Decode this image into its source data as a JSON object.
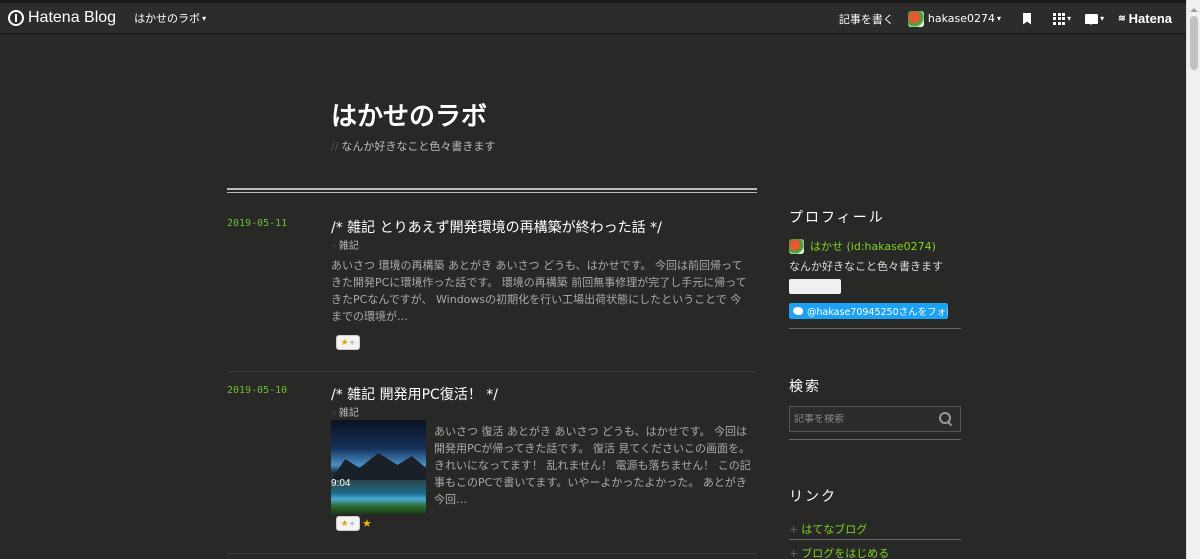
{
  "topbar": {
    "brand": "Hatena Blog",
    "blog_menu": "はかせのラボ",
    "write_label": "記事を書く",
    "username": "hakase0274",
    "hatena_label": "Hatena"
  },
  "header": {
    "title": "はかせのラボ",
    "description": "なんか好きなこと色々書きます",
    "desc_marker": "//"
  },
  "entries": [
    {
      "date": "2019-05-11",
      "title": "/*  雑記 とりあえず開発環境の再構築が終わった話  */",
      "category": "雑記",
      "body": "あいさつ 環境の再構築 あとがき あいさつ どうも、はかせです。 今回は前回帰ってきた開発PCに環境作った話です。 環境の再構築 前回無事修理が完了し手元に帰ってきたPCなんですが、 Windowsの初期化を行い工場出荷状態にしたということで 今までの環境が…"
    },
    {
      "date": "2019-05-10",
      "title": "/*  雑記 開発用PC復活！  */",
      "category": "雑記",
      "thumb_time": "9:04",
      "body": "あいさつ 復活 あとがき あいさつ どうも、はかせです。 今回は開発用PCが帰ってきた話です。 復活 見てくださいこの画面を。 きれいになってます！ 乱れません！ 電源も落ちません！ この記事もこのPCで書いてます。いやーよかったよかった。 あとがき 今回…"
    }
  ],
  "sidebar": {
    "profile_heading": "プロフィール",
    "profile_name": "はかせ (id:hakase0274)",
    "profile_desc": "なんか好きなこと色々書きます",
    "twitter_follow": "@hakase70945250さんをフォロー",
    "search_heading": "検索",
    "search_placeholder": "記事を検索",
    "links_heading": "リンク",
    "links": [
      "はてなブログ",
      "ブログをはじめる"
    ]
  },
  "colors": {
    "background": "#282826",
    "accent_green": "#7ed321",
    "date_green": "#6bbf3a",
    "twitter_blue": "#1da1f2"
  }
}
